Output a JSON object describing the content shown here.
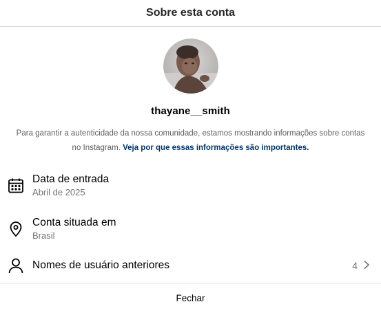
{
  "header": {
    "title": "Sobre esta conta"
  },
  "profile": {
    "username": "thayane__smith",
    "description": "Para garantir a autenticidade da nossa comunidade, estamos mostrando informações sobre contas no Instagram.",
    "link_text": "Veja por que essas informações são importantes."
  },
  "rows": [
    {
      "icon": "calendar-icon",
      "title": "Data de entrada",
      "subtitle": "Abril de 2025"
    },
    {
      "icon": "location-pin-icon",
      "title": "Conta situada em",
      "subtitle": "Brasil"
    },
    {
      "icon": "user-icon",
      "title": "Nomes de usuário anteriores",
      "count": "4"
    }
  ],
  "footer": {
    "close_label": "Fechar"
  }
}
